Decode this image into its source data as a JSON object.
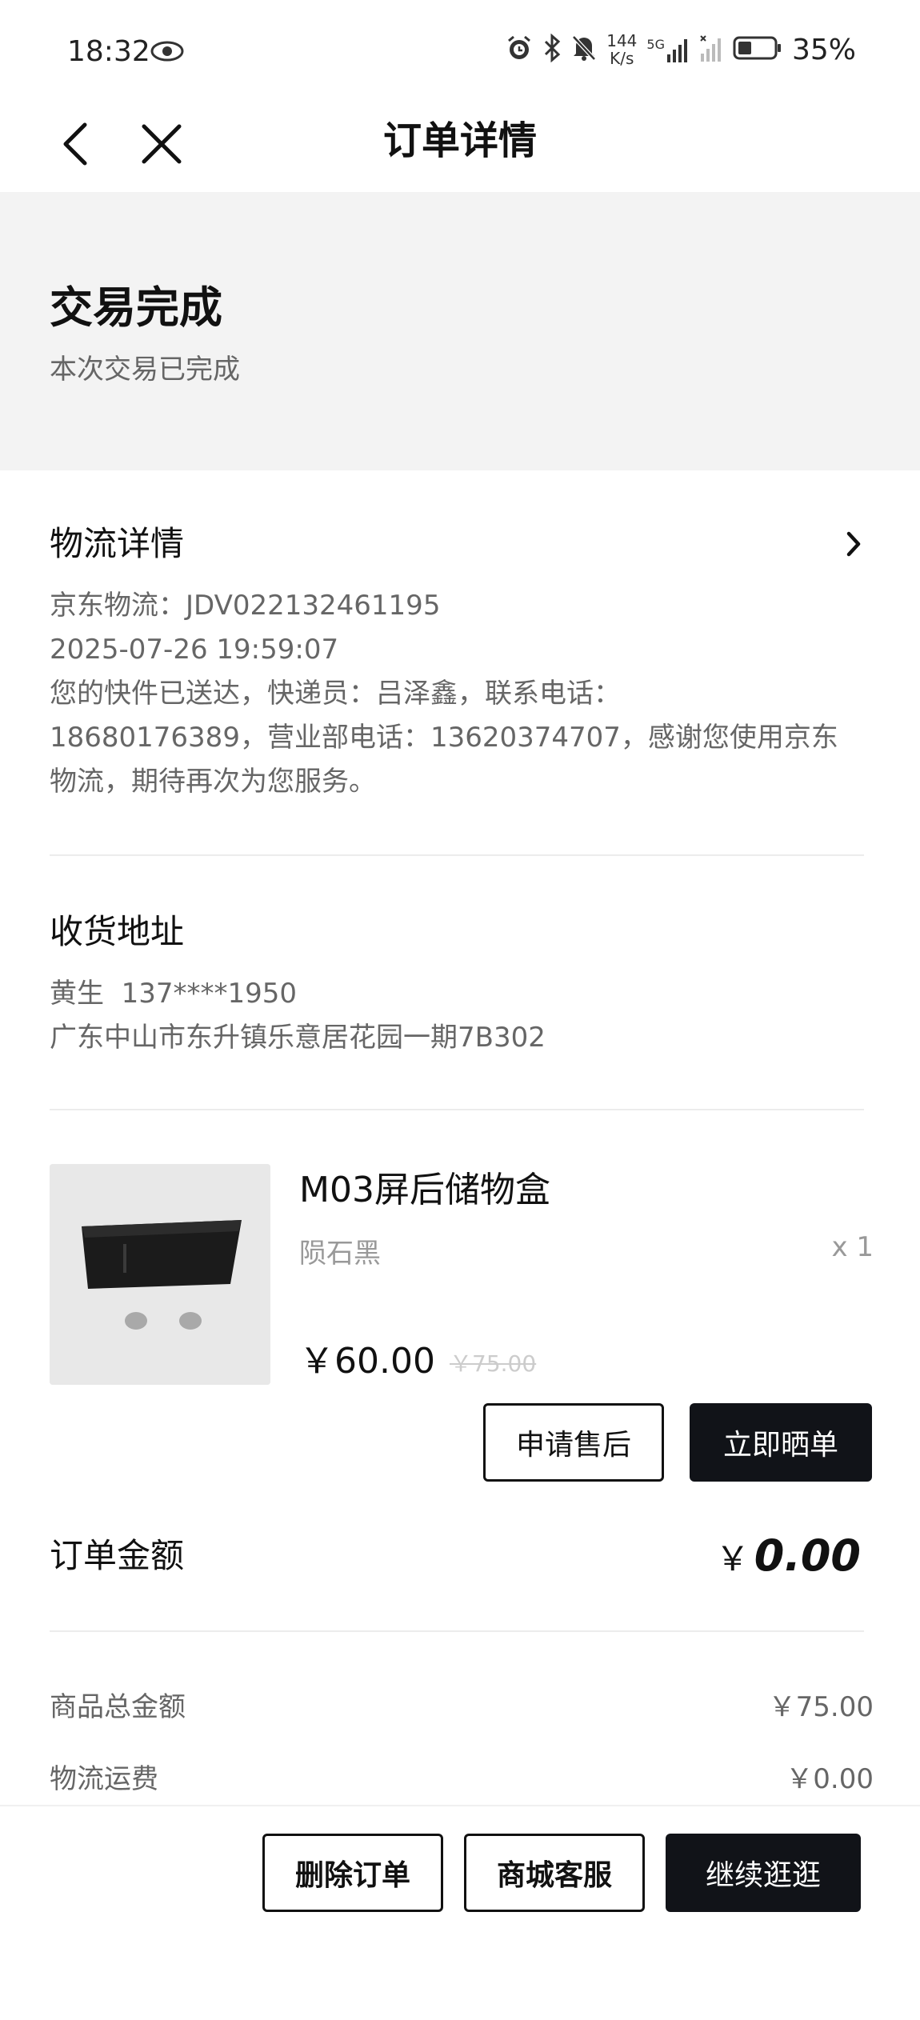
{
  "status_bar": {
    "time": "18:32",
    "net_speed_value": "144",
    "net_speed_unit": "K/s",
    "signal_label": "5G",
    "battery": "35%"
  },
  "nav": {
    "title": "订单详情",
    "back_icon": "chevron-left-icon",
    "close_icon": "close-icon"
  },
  "banner": {
    "title": "交易完成",
    "subtitle": "本次交易已完成"
  },
  "logistics": {
    "title": "物流详情",
    "carrier_line": "京东物流：JDV022132461195",
    "time_line": "2025-07-26 19:59:07",
    "message_lines": [
      "您的快件已送达，快递员：吕泽鑫，联系电话：",
      "18680176389，营业部电话：13620374707，感谢您使用京东",
      "物流，期待再次为您服务。"
    ]
  },
  "address": {
    "title": "收货地址",
    "contact": "黄生  137****1950",
    "detail": "广东中山市东升镇乐意居花园一期7B302"
  },
  "product": {
    "name": "M03屏后储物盒",
    "variant": "陨石黑",
    "qty": "x 1",
    "price": "￥60.00",
    "original_price": "￥75.00",
    "after_sale_label": "申请售后",
    "review_label": "立即晒单"
  },
  "order_total": {
    "label": "订单金额",
    "currency": "￥",
    "amount": "0.00"
  },
  "fees": [
    {
      "label": "商品总金额",
      "value": "￥75.00"
    },
    {
      "label": "物流运费",
      "value": "￥0.00"
    }
  ],
  "bottom_actions": {
    "delete_label": "删除订单",
    "service_label": "商城客服",
    "continue_label": "继续逛逛"
  },
  "colors": {
    "primary_dark": "#111318",
    "banner_bg": "#f3f3f3",
    "muted_text": "#666666"
  }
}
